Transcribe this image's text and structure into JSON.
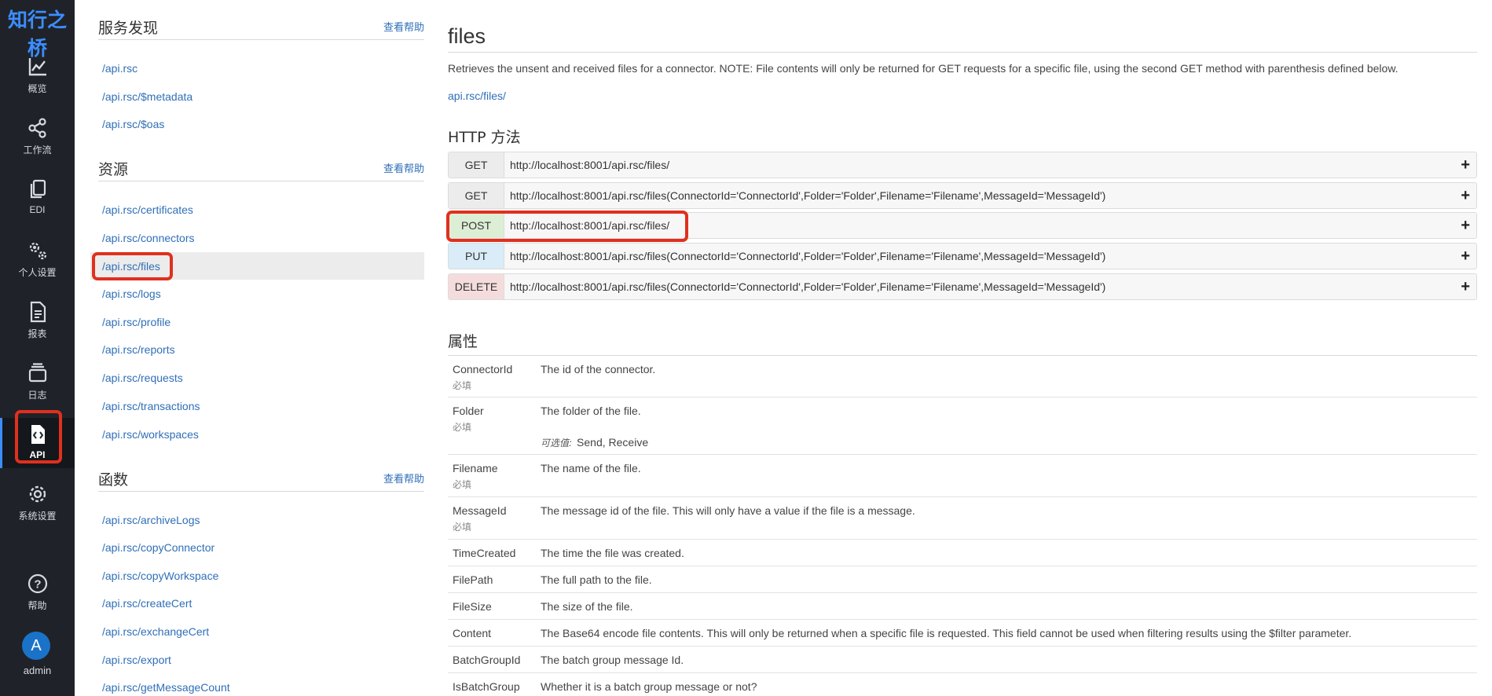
{
  "rail": {
    "logo": "知行之桥",
    "items": [
      {
        "label": "概览",
        "icon": "chart-line-icon"
      },
      {
        "label": "工作流",
        "icon": "share-nodes-icon"
      },
      {
        "label": "EDI",
        "icon": "copy-icon"
      },
      {
        "label": "个人设置",
        "icon": "gears-icon"
      },
      {
        "label": "报表",
        "icon": "document-icon"
      },
      {
        "label": "日志",
        "icon": "stack-icon"
      },
      {
        "label": "API",
        "icon": "code-file-icon"
      },
      {
        "label": "系统设置",
        "icon": "gear-icon"
      },
      {
        "label": "帮助",
        "icon": "help-circle-icon"
      }
    ],
    "avatar_letter": "A",
    "user": "admin"
  },
  "nav": {
    "sections": [
      {
        "title": "服务发现",
        "help": "查看帮助",
        "links": [
          "/api.rsc",
          "/api.rsc/$metadata",
          "/api.rsc/$oas"
        ]
      },
      {
        "title": "资源",
        "help": "查看帮助",
        "links": [
          "/api.rsc/certificates",
          "/api.rsc/connectors",
          "/api.rsc/files",
          "/api.rsc/logs",
          "/api.rsc/profile",
          "/api.rsc/reports",
          "/api.rsc/requests",
          "/api.rsc/transactions",
          "/api.rsc/workspaces"
        ]
      },
      {
        "title": "函数",
        "help": "查看帮助",
        "links": [
          "/api.rsc/archiveLogs",
          "/api.rsc/copyConnector",
          "/api.rsc/copyWorkspace",
          "/api.rsc/createCert",
          "/api.rsc/exchangeCert",
          "/api.rsc/export",
          "/api.rsc/getMessageCount"
        ]
      }
    ]
  },
  "main": {
    "title": "files",
    "description": "Retrieves the unsent and received files for a connector. NOTE: File contents will only be returned for GET requests for a specific file, using the second GET method with parenthesis defined below.",
    "path": "api.rsc/files/",
    "methods_title": "HTTP 方法",
    "methods": [
      {
        "verb": "GET",
        "url": "http://localhost:8001/api.rsc/files/",
        "color": "#ececec"
      },
      {
        "verb": "GET",
        "url": "http://localhost:8001/api.rsc/files(ConnectorId='ConnectorId',Folder='Folder',Filename='Filename',MessageId='MessageId')",
        "color": "#ececec"
      },
      {
        "verb": "POST",
        "url": "http://localhost:8001/api.rsc/files/",
        "color": "#dcefd5"
      },
      {
        "verb": "PUT",
        "url": "http://localhost:8001/api.rsc/files(ConnectorId='ConnectorId',Folder='Folder',Filename='Filename',MessageId='MessageId')",
        "color": "#d9ecf7"
      },
      {
        "verb": "DELETE",
        "url": "http://localhost:8001/api.rsc/files(ConnectorId='ConnectorId',Folder='Folder',Filename='Filename',MessageId='MessageId')",
        "color": "#f5dcdc"
      }
    ],
    "expand_symbol": "+",
    "props_title": "属性",
    "required_label": "必填",
    "options_label": "可选值:",
    "properties": [
      {
        "name": "ConnectorId",
        "desc": "The id of the connector.",
        "required": true
      },
      {
        "name": "Folder",
        "desc": "The folder of the file.",
        "required": true,
        "options": "Send, Receive"
      },
      {
        "name": "Filename",
        "desc": "The name of the file.",
        "required": true
      },
      {
        "name": "MessageId",
        "desc": "The message id of the file. This will only have a value if the file is a message.",
        "required": true
      },
      {
        "name": "TimeCreated",
        "desc": "The time the file was created.",
        "required": false
      },
      {
        "name": "FilePath",
        "desc": "The full path to the file.",
        "required": false
      },
      {
        "name": "FileSize",
        "desc": "The size of the file.",
        "required": false
      },
      {
        "name": "Content",
        "desc": "The Base64 encode file contents. This will only be returned when a specific file is requested. This field cannot be used when filtering results using the $filter parameter.",
        "required": false
      },
      {
        "name": "BatchGroupId",
        "desc": "The batch group message Id.",
        "required": false
      },
      {
        "name": "IsBatchGroup",
        "desc": "Whether it is a batch group message or not?",
        "required": false
      }
    ]
  },
  "highlight_color": "#e0301e",
  "accent_color": "#3c8dff"
}
